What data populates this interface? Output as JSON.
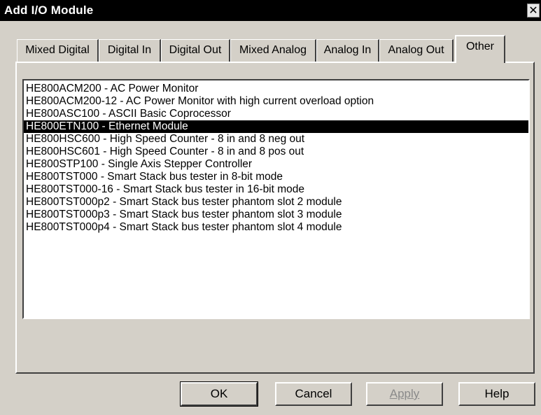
{
  "window": {
    "title": "Add I/O Module",
    "close_glyph": "✕"
  },
  "tabs": [
    {
      "label": "Mixed Digital"
    },
    {
      "label": "Digital In"
    },
    {
      "label": "Digital Out"
    },
    {
      "label": "Mixed Analog"
    },
    {
      "label": "Analog In"
    },
    {
      "label": "Analog Out"
    },
    {
      "label": "Other",
      "active": true
    }
  ],
  "modules": [
    "HE800ACM200  -  AC Power Monitor",
    "HE800ACM200-12  -  AC Power Monitor with high current overload option",
    "HE800ASC100  -  ASCII Basic Coprocessor",
    "HE800ETN100  -  Ethernet Module",
    "HE800HSC600  -  High Speed Counter - 8 in and 8 neg out",
    "HE800HSC601  -  High Speed Counter - 8 in and 8 pos out",
    "HE800STP100  -  Single Axis Stepper Controller",
    "HE800TST000  -  Smart Stack bus tester in 8-bit mode",
    "HE800TST000-16  -  Smart Stack bus tester in 16-bit mode",
    "HE800TST000p2  -  Smart Stack bus tester phantom slot 2 module",
    "HE800TST000p3  -  Smart Stack bus tester phantom slot 3 module",
    "HE800TST000p4  -  Smart Stack bus tester phantom slot 4 module"
  ],
  "selected_module": "HE800ETN100  -  Ethernet Module",
  "buttons": {
    "ok": "OK",
    "cancel": "Cancel",
    "apply": "Apply",
    "help": "Help"
  }
}
